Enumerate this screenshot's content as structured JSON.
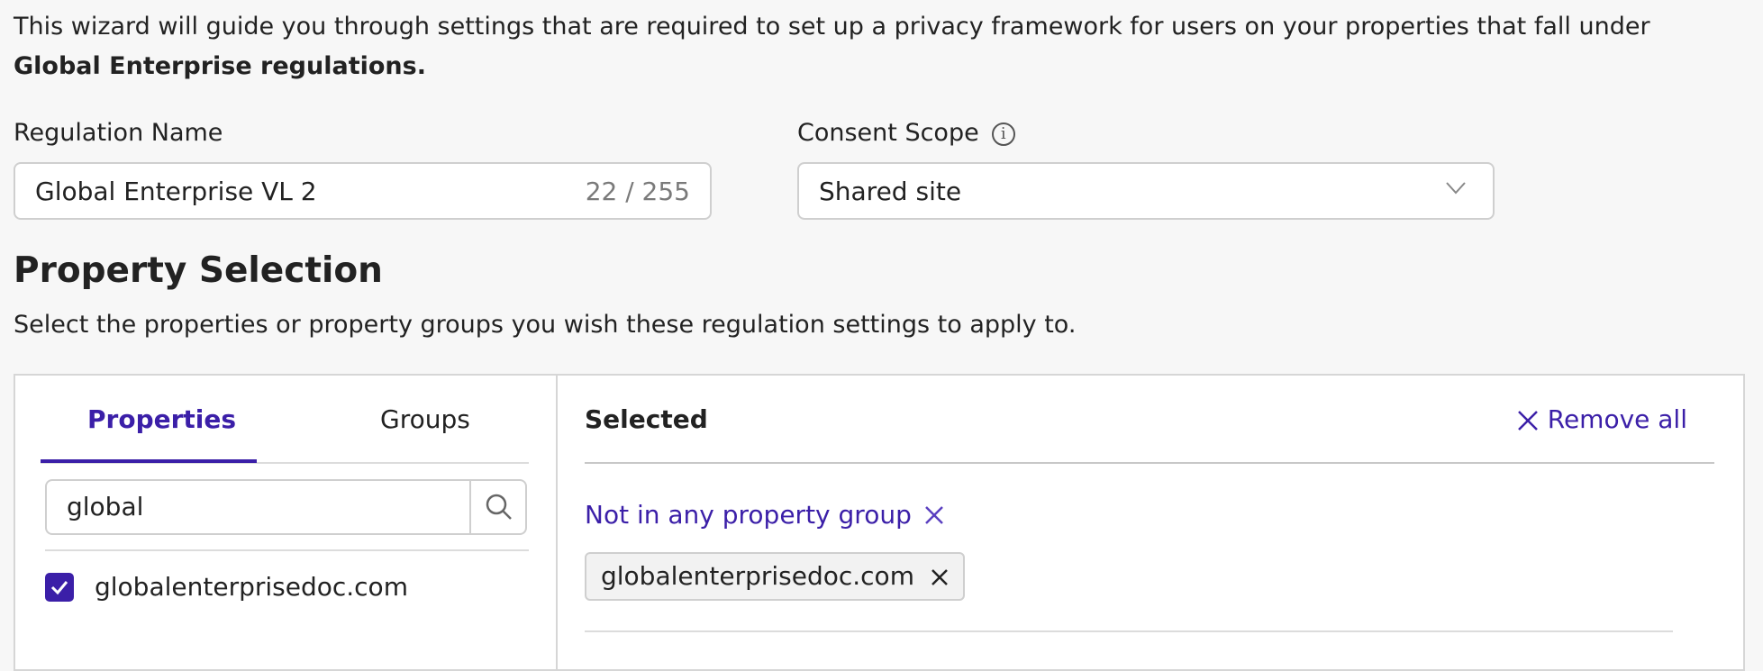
{
  "intro": {
    "text": "This wizard will guide you through settings that are required to set up a privacy framework for users on your properties that fall under ",
    "bold": "Global Enterprise regulations."
  },
  "regulation_name": {
    "label": "Regulation Name",
    "value": "Global Enterprise VL 2",
    "counter": "22 / 255"
  },
  "consent_scope": {
    "label": "Consent Scope",
    "value": "Shared site",
    "info_icon": "info-icon"
  },
  "property_selection": {
    "title": "Property Selection",
    "subtitle": "Select the properties or property groups you wish these regulation settings to apply to.",
    "tabs": [
      {
        "label": "Properties",
        "active": true
      },
      {
        "label": "Groups",
        "active": false
      }
    ],
    "search": {
      "value": "global"
    },
    "results": [
      {
        "label": "globalenterprisedoc.com",
        "checked": true
      }
    ],
    "selected": {
      "title": "Selected",
      "remove_all": "Remove all",
      "group_label": "Not in any property group",
      "chips": [
        {
          "label": "globalenterprisedoc.com"
        }
      ]
    }
  },
  "colors": {
    "accent": "#3b1fa8",
    "background": "#f7f7f7"
  }
}
